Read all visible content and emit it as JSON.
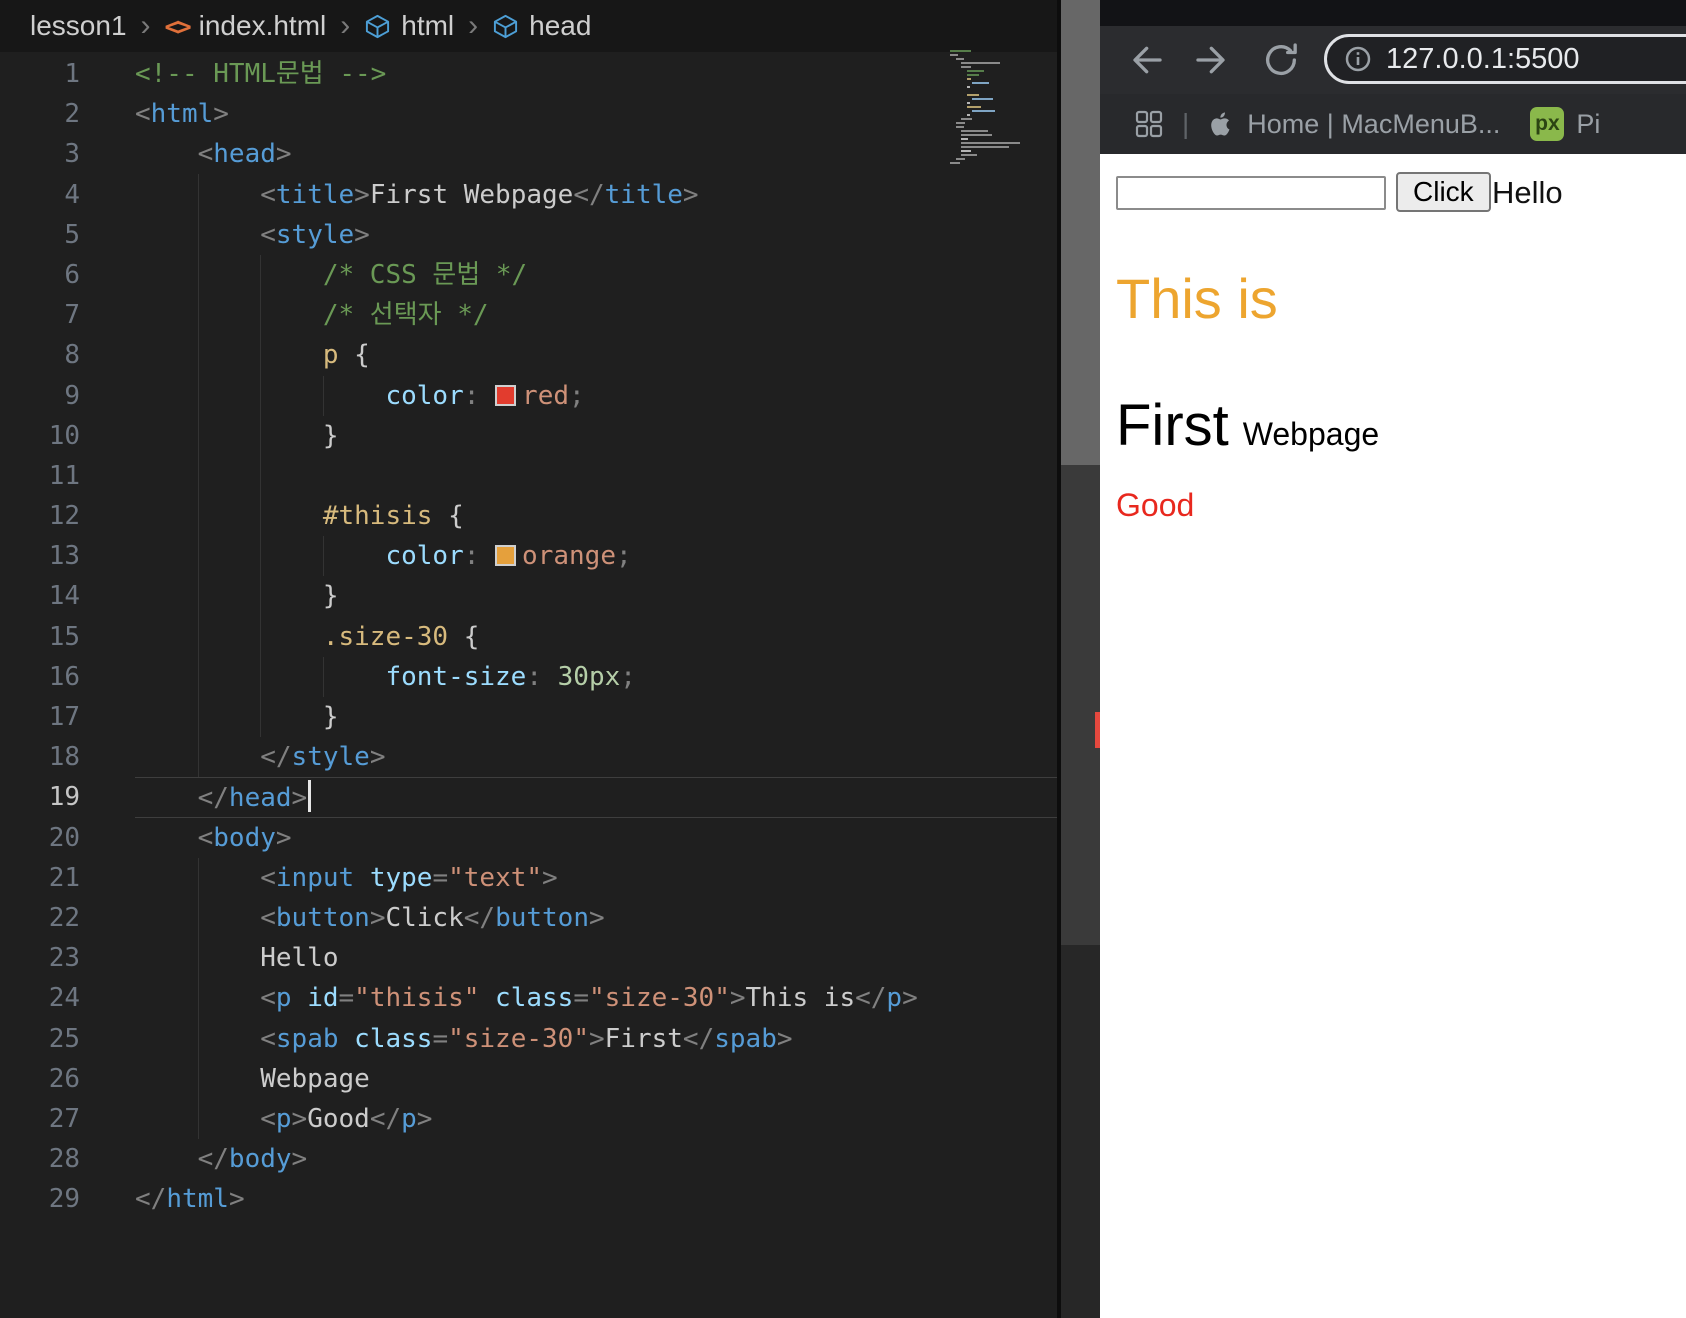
{
  "editor": {
    "breadcrumb": {
      "items": [
        "lesson1",
        "index.html",
        "html",
        "head"
      ]
    },
    "current_line": 19,
    "lines": [
      {
        "n": 1,
        "tokens": [
          {
            "c": "comment",
            "t": "<!-- HTML문법 -->"
          }
        ]
      },
      {
        "n": 2,
        "tokens": [
          {
            "c": "punct",
            "t": "<"
          },
          {
            "c": "tag",
            "t": "html"
          },
          {
            "c": "punct",
            "t": ">"
          }
        ]
      },
      {
        "n": 3,
        "tokens": [
          {
            "c": "punct",
            "t": "    <"
          },
          {
            "c": "tag",
            "t": "head"
          },
          {
            "c": "punct",
            "t": ">"
          }
        ]
      },
      {
        "n": 4,
        "tokens": [
          {
            "c": "punct",
            "t": "        <"
          },
          {
            "c": "tag",
            "t": "title"
          },
          {
            "c": "punct",
            "t": ">"
          },
          {
            "c": "text",
            "t": "First Webpage"
          },
          {
            "c": "punct",
            "t": "</"
          },
          {
            "c": "tag",
            "t": "title"
          },
          {
            "c": "punct",
            "t": ">"
          }
        ]
      },
      {
        "n": 5,
        "tokens": [
          {
            "c": "punct",
            "t": "        <"
          },
          {
            "c": "tag",
            "t": "style"
          },
          {
            "c": "punct",
            "t": ">"
          }
        ]
      },
      {
        "n": 6,
        "tokens": [
          {
            "c": "comment",
            "t": "            /* CSS 문법 */"
          }
        ]
      },
      {
        "n": 7,
        "tokens": [
          {
            "c": "comment",
            "t": "            /* 선택자 */"
          }
        ]
      },
      {
        "n": 8,
        "tokens": [
          {
            "c": "selector",
            "t": "            p"
          },
          {
            "c": "text",
            "t": " {"
          }
        ]
      },
      {
        "n": 9,
        "tokens": [
          {
            "c": "prop",
            "t": "                color"
          },
          {
            "c": "punct",
            "t": ": "
          },
          {
            "c": "swatch",
            "color": "#e23c2e"
          },
          {
            "c": "val",
            "t": "red"
          },
          {
            "c": "punct",
            "t": ";"
          }
        ]
      },
      {
        "n": 10,
        "tokens": [
          {
            "c": "text",
            "t": "            }"
          }
        ]
      },
      {
        "n": 11,
        "tokens": []
      },
      {
        "n": 12,
        "tokens": [
          {
            "c": "selector",
            "t": "            #thisis"
          },
          {
            "c": "text",
            "t": " {"
          }
        ]
      },
      {
        "n": 13,
        "tokens": [
          {
            "c": "prop",
            "t": "                color"
          },
          {
            "c": "punct",
            "t": ": "
          },
          {
            "c": "swatch",
            "color": "#e5a03c"
          },
          {
            "c": "val",
            "t": "orange"
          },
          {
            "c": "punct",
            "t": ";"
          }
        ]
      },
      {
        "n": 14,
        "tokens": [
          {
            "c": "text",
            "t": "            }"
          }
        ]
      },
      {
        "n": 15,
        "tokens": [
          {
            "c": "selector",
            "t": "            .size-30"
          },
          {
            "c": "text",
            "t": " {"
          }
        ]
      },
      {
        "n": 16,
        "tokens": [
          {
            "c": "prop",
            "t": "                font-size"
          },
          {
            "c": "punct",
            "t": ": "
          },
          {
            "c": "num",
            "t": "30px"
          },
          {
            "c": "punct",
            "t": ";"
          }
        ]
      },
      {
        "n": 17,
        "tokens": [
          {
            "c": "text",
            "t": "            }"
          }
        ]
      },
      {
        "n": 18,
        "tokens": [
          {
            "c": "punct",
            "t": "        </"
          },
          {
            "c": "tag",
            "t": "style"
          },
          {
            "c": "punct",
            "t": ">"
          }
        ]
      },
      {
        "n": 19,
        "tokens": [
          {
            "c": "punct",
            "t": "    </"
          },
          {
            "c": "tag",
            "t": "head"
          },
          {
            "c": "punct",
            "t": ">"
          }
        ]
      },
      {
        "n": 20,
        "tokens": [
          {
            "c": "punct",
            "t": "    <"
          },
          {
            "c": "tag",
            "t": "body"
          },
          {
            "c": "punct",
            "t": ">"
          }
        ]
      },
      {
        "n": 21,
        "tokens": [
          {
            "c": "punct",
            "t": "        <"
          },
          {
            "c": "tag",
            "t": "input"
          },
          {
            "c": "attr",
            "t": " type"
          },
          {
            "c": "punct",
            "t": "="
          },
          {
            "c": "string",
            "t": "\"text\""
          },
          {
            "c": "punct",
            "t": ">"
          }
        ]
      },
      {
        "n": 22,
        "tokens": [
          {
            "c": "punct",
            "t": "        <"
          },
          {
            "c": "tag",
            "t": "button"
          },
          {
            "c": "punct",
            "t": ">"
          },
          {
            "c": "text",
            "t": "Click"
          },
          {
            "c": "punct",
            "t": "</"
          },
          {
            "c": "tag",
            "t": "button"
          },
          {
            "c": "punct",
            "t": ">"
          }
        ]
      },
      {
        "n": 23,
        "tokens": [
          {
            "c": "text",
            "t": "        Hello"
          }
        ]
      },
      {
        "n": 24,
        "tokens": [
          {
            "c": "punct",
            "t": "        <"
          },
          {
            "c": "tag",
            "t": "p"
          },
          {
            "c": "attr",
            "t": " id"
          },
          {
            "c": "punct",
            "t": "="
          },
          {
            "c": "string",
            "t": "\"thisis\""
          },
          {
            "c": "attr",
            "t": " class"
          },
          {
            "c": "punct",
            "t": "="
          },
          {
            "c": "string",
            "t": "\"size-30\""
          },
          {
            "c": "punct",
            "t": ">"
          },
          {
            "c": "text",
            "t": "This is"
          },
          {
            "c": "punct",
            "t": "</"
          },
          {
            "c": "tag",
            "t": "p"
          },
          {
            "c": "punct",
            "t": ">"
          }
        ]
      },
      {
        "n": 25,
        "tokens": [
          {
            "c": "punct",
            "t": "        <"
          },
          {
            "c": "tag",
            "t": "spab"
          },
          {
            "c": "attr",
            "t": " class"
          },
          {
            "c": "punct",
            "t": "="
          },
          {
            "c": "string",
            "t": "\"size-30\""
          },
          {
            "c": "punct",
            "t": ">"
          },
          {
            "c": "text",
            "t": "First"
          },
          {
            "c": "punct",
            "t": "</"
          },
          {
            "c": "tag",
            "t": "spab"
          },
          {
            "c": "punct",
            "t": ">"
          }
        ]
      },
      {
        "n": 26,
        "tokens": [
          {
            "c": "text",
            "t": "        Webpage"
          }
        ]
      },
      {
        "n": 27,
        "tokens": [
          {
            "c": "punct",
            "t": "        <"
          },
          {
            "c": "tag",
            "t": "p"
          },
          {
            "c": "punct",
            "t": ">"
          },
          {
            "c": "text",
            "t": "Good"
          },
          {
            "c": "punct",
            "t": "</"
          },
          {
            "c": "tag",
            "t": "p"
          },
          {
            "c": "punct",
            "t": ">"
          }
        ]
      },
      {
        "n": 28,
        "tokens": [
          {
            "c": "punct",
            "t": "    </"
          },
          {
            "c": "tag",
            "t": "body"
          },
          {
            "c": "punct",
            "t": ">"
          }
        ]
      },
      {
        "n": 29,
        "tokens": [
          {
            "c": "punct",
            "t": "</"
          },
          {
            "c": "tag",
            "t": "html"
          },
          {
            "c": "punct",
            "t": ">"
          }
        ]
      }
    ]
  },
  "browser": {
    "nav": {
      "url": "127.0.0.1:5500"
    },
    "bookmarks": {
      "home_label": "Home | MacMenuB...",
      "px_badge": "px",
      "px_label": "Pi"
    },
    "page": {
      "button_label": "Click",
      "hello": "Hello",
      "this_is": "This is",
      "first": "First",
      "webpage": "Webpage",
      "good": "Good"
    }
  },
  "colors": {
    "this_is": "#eda52f",
    "good": "#e8281e"
  }
}
